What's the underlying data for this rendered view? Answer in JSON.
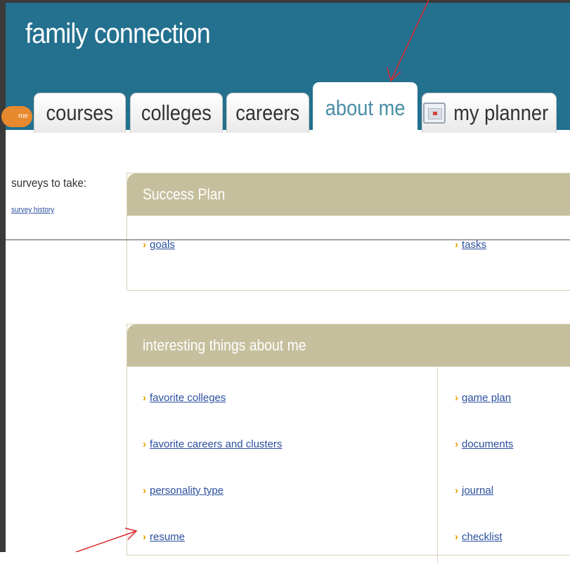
{
  "app": {
    "title": "family connection"
  },
  "nav": {
    "home_partial": "me",
    "tabs": [
      {
        "label": "courses"
      },
      {
        "label": "colleges"
      },
      {
        "label": "careers"
      },
      {
        "label": "about me",
        "active": true
      },
      {
        "label": "my planner",
        "icon": "planner-icon"
      }
    ]
  },
  "sidebar": {
    "surveys_label": "surveys to take:",
    "survey_history_link": "survey history"
  },
  "success_plan": {
    "title": "Success Plan",
    "links": [
      "goals",
      "tasks"
    ]
  },
  "interesting": {
    "title": "interesting things about me",
    "left_links": [
      "favorite colleges",
      "favorite careers and clusters",
      "personality type",
      "resume"
    ],
    "right_links": [
      "game plan",
      "documents",
      "journal",
      "checklist"
    ]
  },
  "colors": {
    "header_bg": "#23708f",
    "panel_header_bg": "#c5bf9d",
    "link": "#2b4f9e",
    "chevron": "#e6a100",
    "annotation_arrow": "#d9262c"
  }
}
